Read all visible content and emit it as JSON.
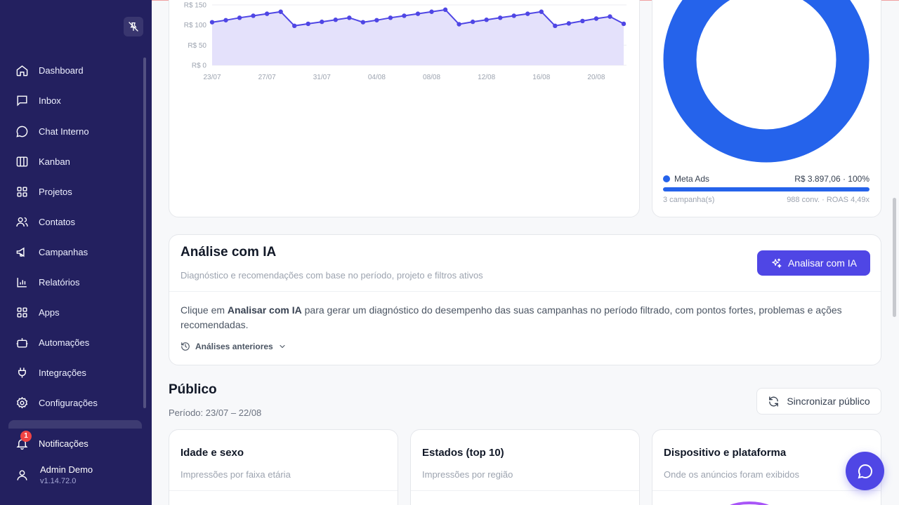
{
  "sidebar": {
    "items": [
      {
        "label": "Dashboard",
        "icon": "home-icon"
      },
      {
        "label": "Inbox",
        "icon": "inbox-icon"
      },
      {
        "label": "Chat Interno",
        "icon": "chat-icon"
      },
      {
        "label": "Kanban",
        "icon": "kanban-icon"
      },
      {
        "label": "Projetos",
        "icon": "grid-icon"
      },
      {
        "label": "Contatos",
        "icon": "users-icon"
      },
      {
        "label": "Campanhas",
        "icon": "megaphone-icon"
      },
      {
        "label": "Relatórios",
        "icon": "bar-chart-icon"
      },
      {
        "label": "Apps",
        "icon": "apps-icon"
      },
      {
        "label": "Automações",
        "icon": "bot-icon"
      },
      {
        "label": "Integrações",
        "icon": "plug-icon"
      },
      {
        "label": "Configurações",
        "icon": "gear-icon"
      }
    ],
    "notifications": {
      "label": "Notificações",
      "count": "1"
    },
    "user": {
      "name": "Admin Demo",
      "version": "v1.14.72.0"
    }
  },
  "revenue_chart": {
    "y_ticks": [
      "R$ 150",
      "R$ 100",
      "R$ 50",
      "R$ 0"
    ],
    "x_ticks": [
      "23/07",
      "27/07",
      "31/07",
      "04/08",
      "08/08",
      "12/08",
      "16/08",
      "20/08"
    ],
    "accent": "#4f46e5",
    "fill": "#e4e1fb"
  },
  "chart_data": {
    "type": "area",
    "title": "",
    "xlabel": "",
    "ylabel": "",
    "ylim": [
      0,
      150
    ],
    "x": [
      "23/07",
      "24/07",
      "25/07",
      "26/07",
      "27/07",
      "28/07",
      "29/07",
      "30/07",
      "31/07",
      "01/08",
      "02/08",
      "03/08",
      "04/08",
      "05/08",
      "06/08",
      "07/08",
      "08/08",
      "09/08",
      "10/08",
      "11/08",
      "12/08",
      "13/08",
      "14/08",
      "15/08",
      "16/08",
      "17/08",
      "18/08",
      "19/08",
      "20/08",
      "21/08",
      "22/08"
    ],
    "series": [
      {
        "values": [
          107,
          112,
          118,
          123,
          128,
          133,
          98,
          103,
          108,
          113,
          118,
          107,
          112,
          118,
          123,
          128,
          133,
          138,
          102,
          108,
          113,
          118,
          123,
          128,
          133,
          98,
          104,
          110,
          116,
          121,
          103
        ]
      }
    ]
  },
  "donut": {
    "color": "#2563eb",
    "legend": {
      "name": "Meta Ads",
      "value": "R$ 3.897,06 · 100%",
      "campaigns": "3 campanha(s)",
      "stats": "988 conv. · ROAS 4,49x",
      "share": 1.0
    }
  },
  "ia": {
    "title": "Análise com IA",
    "subtitle": "Diagnóstico e recomendações com base no período, projeto e filtros ativos",
    "button": "Analisar com IA",
    "text_before": "Clique em ",
    "text_bold": "Analisar com IA",
    "text_after": " para gerar um diagnóstico do desempenho das suas campanhas no período filtrado, com pontos fortes, problemas e ações recomendadas.",
    "history": "Análises anteriores"
  },
  "publico": {
    "title": "Público",
    "period": "Período: 23/07 – 22/08",
    "sync_button": "Sincronizar público",
    "cards": [
      {
        "title": "Idade e sexo",
        "subtitle": "Impressões por faixa etária"
      },
      {
        "title": "Estados (top 10)",
        "subtitle": "Impressões por região"
      },
      {
        "title": "Dispositivo e plataforma",
        "subtitle": "Onde os anúncios foram exibidos"
      }
    ]
  }
}
